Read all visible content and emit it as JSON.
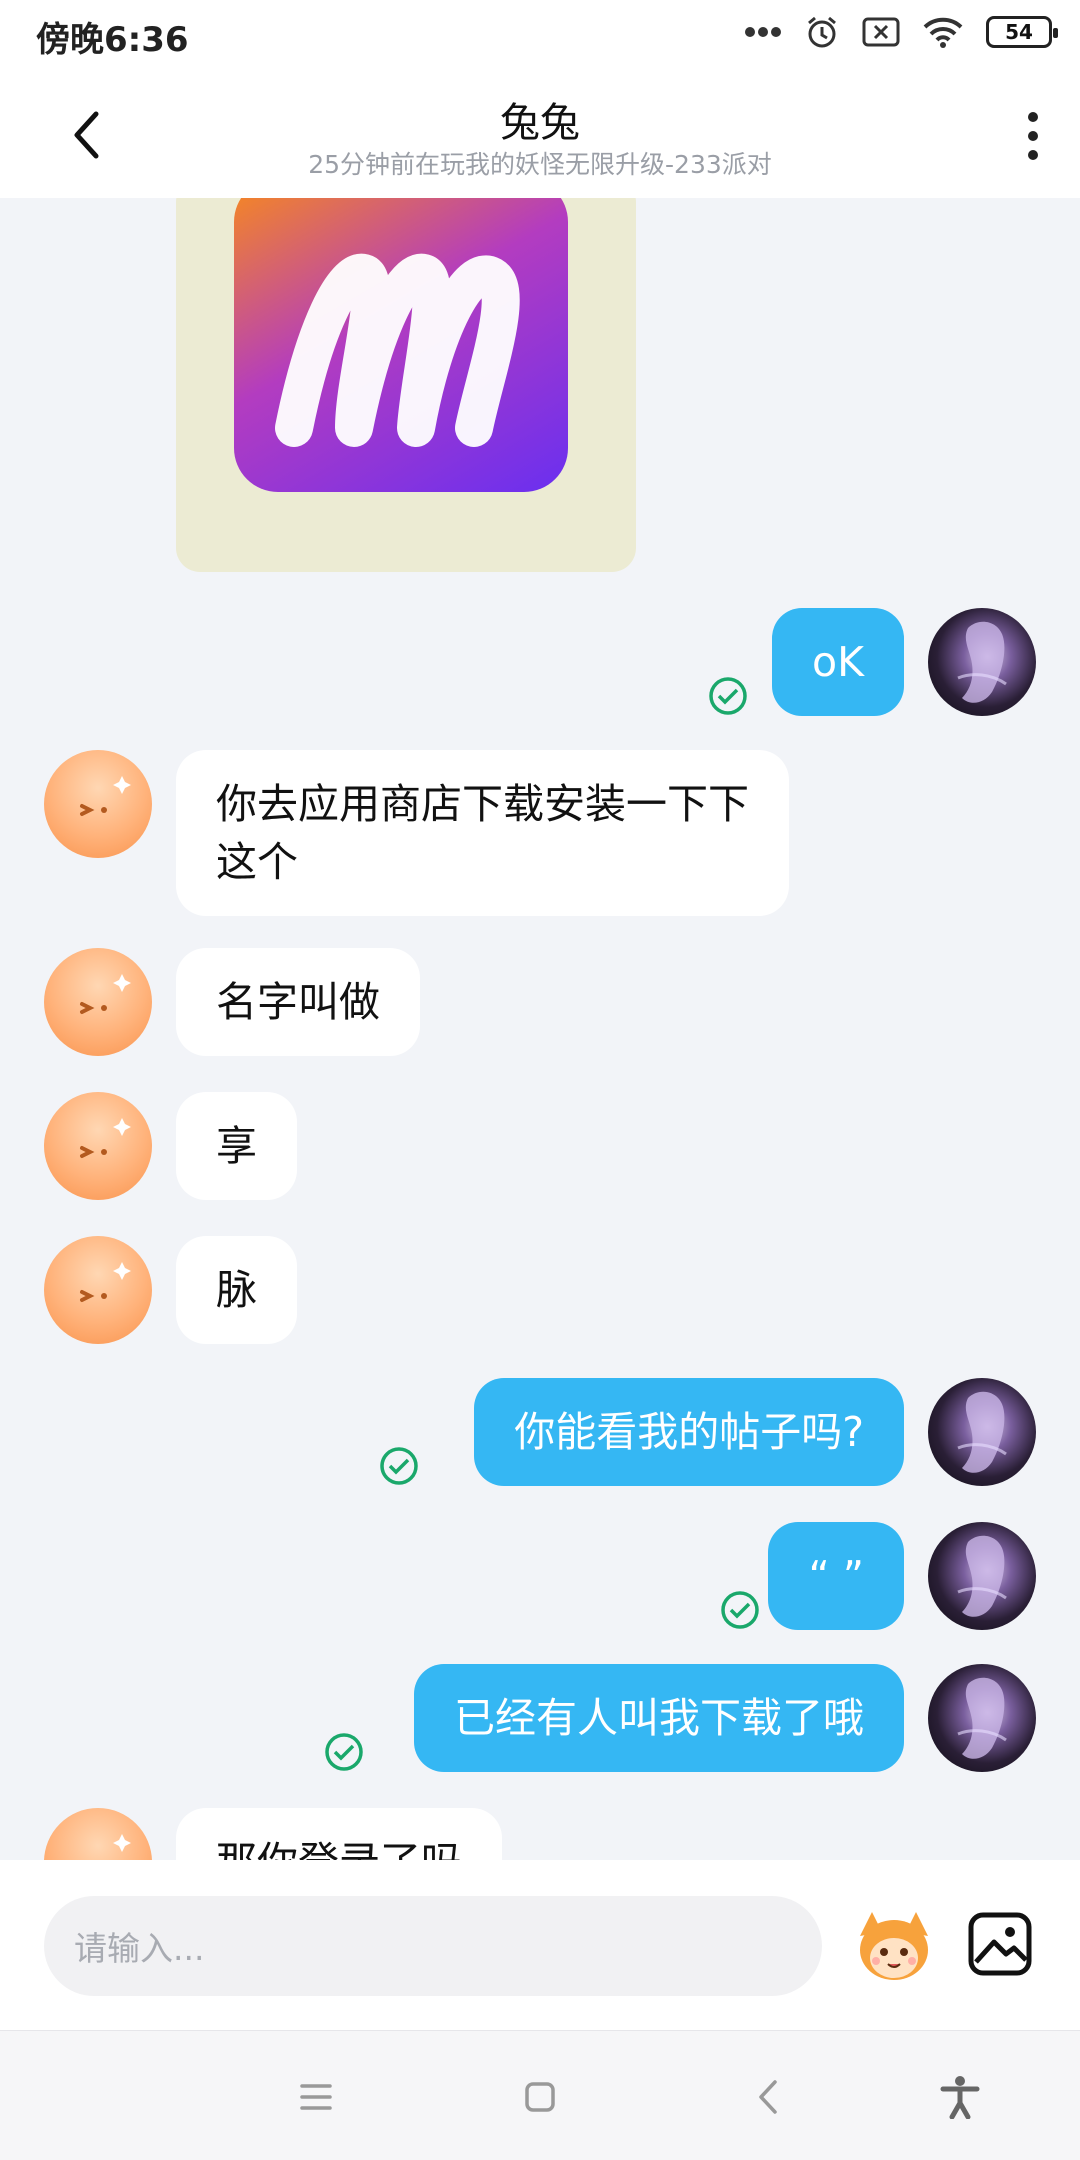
{
  "status_bar": {
    "time": "傍晚6:36",
    "battery": "54",
    "icons": [
      "dots-icon",
      "alarm-icon",
      "sim-off-icon",
      "wifi-icon",
      "battery-icon"
    ]
  },
  "header": {
    "title": "兔兔",
    "subtitle": "25分钟前在玩我的妖怪无限升级-233派对"
  },
  "messages": [
    {
      "side": "left",
      "type": "image",
      "content": "app-logo-m"
    },
    {
      "side": "right",
      "type": "text",
      "text": "oK",
      "status": "read"
    },
    {
      "side": "left",
      "type": "text",
      "lines": [
        "你去应用商店下载安装一下下",
        "这个"
      ]
    },
    {
      "side": "left",
      "type": "text",
      "text": "名字叫做"
    },
    {
      "side": "left",
      "type": "text",
      "text": "享"
    },
    {
      "side": "left",
      "type": "text",
      "text": "脉"
    },
    {
      "side": "right",
      "type": "text",
      "text": "你能看我的帖子吗?",
      "status": "read"
    },
    {
      "side": "right",
      "type": "text",
      "text": "“ ”",
      "status": "read"
    },
    {
      "side": "right",
      "type": "text",
      "text": "已经有人叫我下载了哦",
      "status": "read"
    },
    {
      "side": "left",
      "type": "text",
      "text": "那你登录了吗"
    }
  ],
  "input": {
    "placeholder": "请输入..."
  },
  "colors": {
    "outgoing_bubble": "#35b7f3",
    "incoming_bubble": "#ffffff",
    "chat_background": "#f2f4f8",
    "read_check": "#1aa86b"
  }
}
